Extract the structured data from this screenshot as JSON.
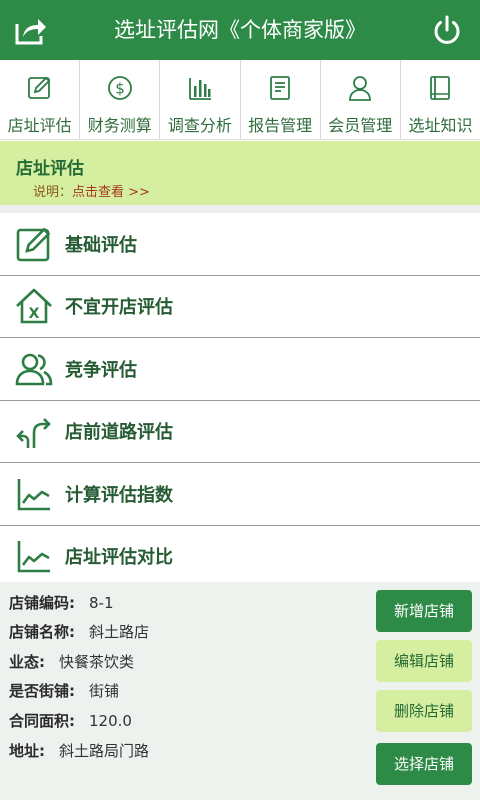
{
  "header": {
    "title": "选址评估网《个体商家版》"
  },
  "nav": [
    {
      "label": "店址评估",
      "icon": "edit-icon"
    },
    {
      "label": "财务测算",
      "icon": "dollar-icon"
    },
    {
      "label": "调查分析",
      "icon": "bar-chart-icon"
    },
    {
      "label": "报告管理",
      "icon": "report-icon"
    },
    {
      "label": "会员管理",
      "icon": "user-icon"
    },
    {
      "label": "选址知识",
      "icon": "book-icon"
    }
  ],
  "notice": {
    "title": "店址评估",
    "desc_prefix": "说明：",
    "desc_link": "点击查看 >>"
  },
  "list": [
    {
      "label": "基础评估",
      "icon": "edit-icon"
    },
    {
      "label": "不宜开店评估",
      "icon": "house-x-icon"
    },
    {
      "label": "竞争评估",
      "icon": "users-icon"
    },
    {
      "label": "店前道路评估",
      "icon": "road-arrows-icon"
    },
    {
      "label": "计算评估指数",
      "icon": "line-chart-icon"
    },
    {
      "label": "店址评估对比",
      "icon": "line-chart-icon"
    }
  ],
  "store": {
    "code_label": "店铺编码:",
    "code": "8-1",
    "name_label": "店铺名称:",
    "name": "斜土路店",
    "type_label": "业态:",
    "type": "快餐茶饮类",
    "street_label": "是否街铺:",
    "street": "街铺",
    "area_label": "合同面积:",
    "area": "120.0",
    "addr_label": "地址:",
    "addr": "斜土路局门路"
  },
  "buttons": {
    "add": "新增店铺",
    "edit": "编辑店铺",
    "delete": "删除店铺",
    "select": "选择店铺"
  },
  "colors": {
    "primary": "#2e8b47",
    "light": "#d6eea0",
    "text": "#265c33"
  }
}
